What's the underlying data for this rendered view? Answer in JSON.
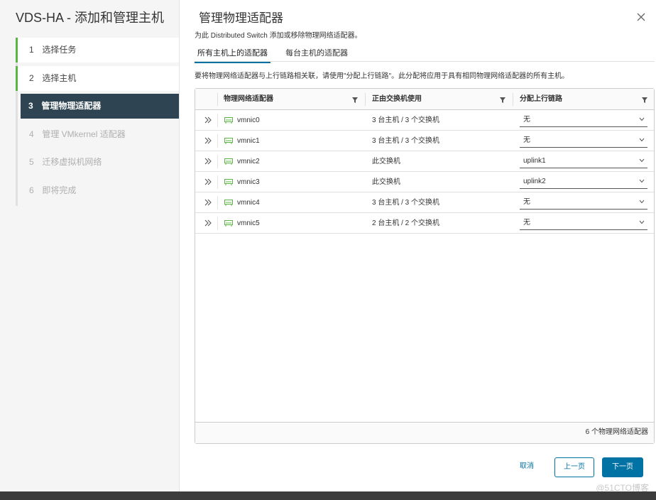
{
  "wizard": {
    "title": "VDS-HA - 添加和管理主机",
    "steps": [
      {
        "num": "1",
        "label": "选择任务",
        "state": "done"
      },
      {
        "num": "2",
        "label": "选择主机",
        "state": "done"
      },
      {
        "num": "3",
        "label": "管理物理适配器",
        "state": "active"
      },
      {
        "num": "4",
        "label": "管理 VMkernel 适配器",
        "state": "future"
      },
      {
        "num": "5",
        "label": "迁移虚拟机网络",
        "state": "future"
      },
      {
        "num": "6",
        "label": "即将完成",
        "state": "future"
      }
    ]
  },
  "page": {
    "title": "管理物理适配器",
    "subtitle": "为此 Distributed Switch 添加或移除物理网络适配器。",
    "tabs": [
      {
        "label": "所有主机上的适配器",
        "active": true
      },
      {
        "label": "每台主机的适配器",
        "active": false
      }
    ],
    "instruction": "要将物理网络适配器与上行链路相关联，请使用\"分配上行链路\"。此分配将应用于具有相同物理网络适配器的所有主机。"
  },
  "grid": {
    "columns": [
      "物理网络适配器",
      "正由交换机使用",
      "分配上行链路"
    ],
    "rows": [
      {
        "nic": "vmnic0",
        "usage": "3 台主机 / 3 个交换机",
        "uplink": "无"
      },
      {
        "nic": "vmnic1",
        "usage": "3 台主机 / 3 个交换机",
        "uplink": "无"
      },
      {
        "nic": "vmnic2",
        "usage": "此交换机",
        "uplink": "uplink1"
      },
      {
        "nic": "vmnic3",
        "usage": "此交换机",
        "uplink": "uplink2"
      },
      {
        "nic": "vmnic4",
        "usage": "3 台主机 / 3 个交换机",
        "uplink": "无"
      },
      {
        "nic": "vmnic5",
        "usage": "2 台主机 / 2 个交换机",
        "uplink": "无"
      }
    ],
    "footer": "6 个物理网络适配器"
  },
  "buttons": {
    "cancel": "取消",
    "prev": "上一页",
    "next": "下一页"
  },
  "watermark": "@51CTO博客",
  "colors": {
    "accent": "#0072a3",
    "active_step_bg": "#2e4452",
    "done_step_marker": "#5db446",
    "nic_icon": "#5db446"
  },
  "icons": {
    "close": "close-icon",
    "filter": "filter-icon",
    "expand": "double-chevron-right-icon",
    "nic": "network-adapter-icon",
    "dropdown": "chevron-down-icon"
  }
}
